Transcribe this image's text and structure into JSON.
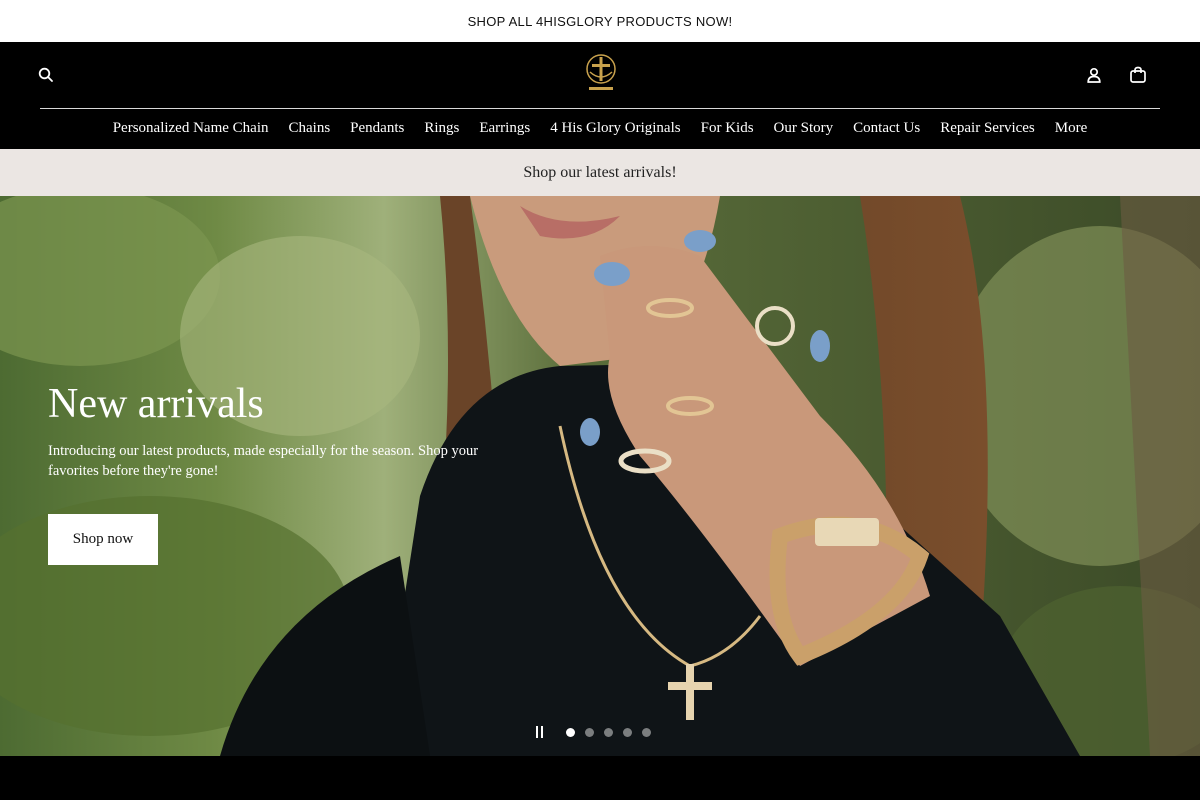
{
  "announcement": {
    "text": "SHOP ALL 4HISGLORY PRODUCTS NOW!"
  },
  "header": {
    "icons": {
      "search": "search-icon",
      "account": "account-icon",
      "cart": "cart-icon"
    },
    "logo_icon": "cross-logo",
    "nav": [
      "Personalized Name Chain",
      "Chains",
      "Pendants",
      "Rings",
      "Earrings",
      "4 His Glory Originals",
      "For Kids",
      "Our Story",
      "Contact Us",
      "Repair Services",
      "More"
    ]
  },
  "promo": {
    "text": "Shop our latest arrivals!"
  },
  "hero": {
    "title": "New arrivals",
    "subtitle": "Introducing our latest products, made especially for the season. Shop your favorites before they're gone!",
    "button_label": "Shop now",
    "slides": {
      "count": 5,
      "active": 1
    }
  },
  "colors": {
    "announcement_bg": "#ffffff",
    "header_bg": "#000000",
    "promo_bg": "#ebe6e3",
    "logo_gold": "#c9a24d"
  }
}
